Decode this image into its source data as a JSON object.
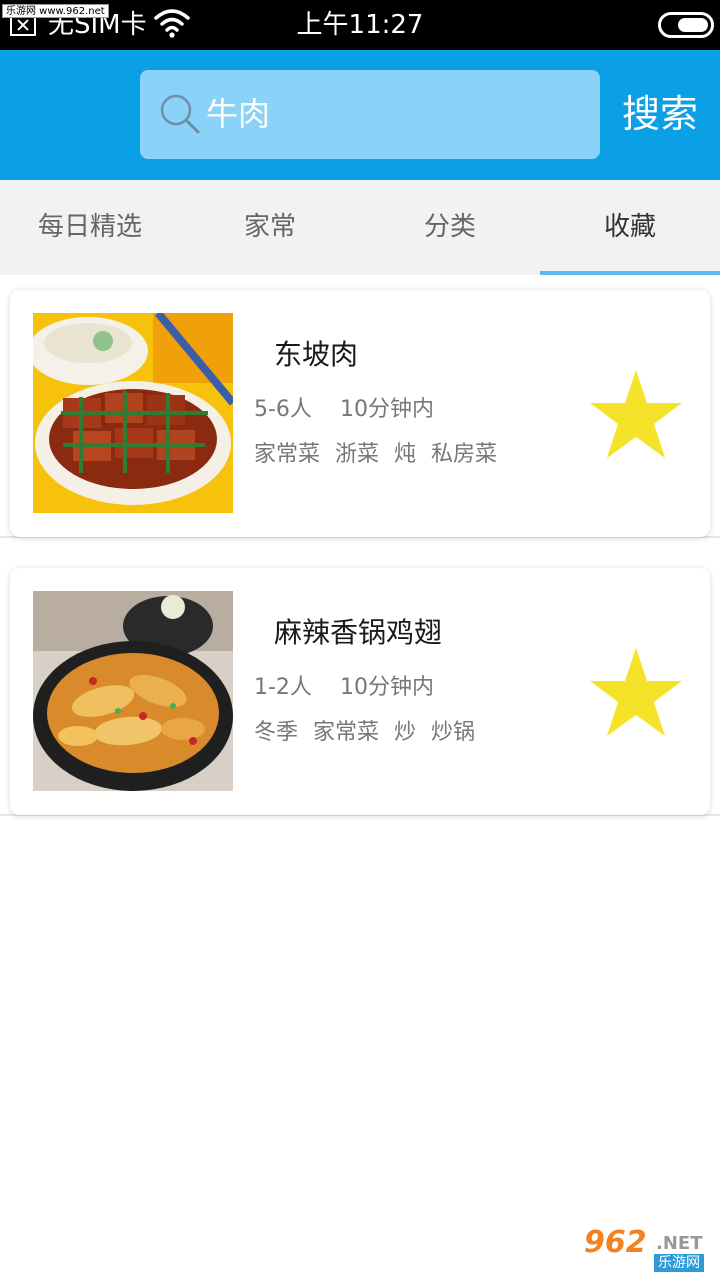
{
  "status_bar": {
    "watermark": "乐游网 www.962.net",
    "carrier": "无SIM卡",
    "time": "上午11:27"
  },
  "search": {
    "query": "牛肉",
    "button_label": "搜索"
  },
  "tabs": [
    {
      "label": "每日精选",
      "active": false
    },
    {
      "label": "家常",
      "active": false
    },
    {
      "label": "分类",
      "active": false
    },
    {
      "label": "收藏",
      "active": true
    }
  ],
  "favorites": [
    {
      "name": "东坡肉",
      "servings": "5-6人",
      "time": "10分钟内",
      "tags": [
        "家常菜",
        "浙菜",
        "炖",
        "私房菜"
      ],
      "favorited": true
    },
    {
      "name": "麻辣香锅鸡翅",
      "servings": "1-2人",
      "time": "10分钟内",
      "tags": [
        "冬季",
        "家常菜",
        "炒",
        "炒锅"
      ],
      "favorited": true
    }
  ],
  "watermark_bottom": {
    "logo_number": "962",
    "logo_suffix": ".NET",
    "logo_cn": "乐游网"
  },
  "colors": {
    "header": "#0b9fe6",
    "search_box": "#8bd2f8",
    "tab_indicator": "#5fb9ec",
    "star": "#f5e32a"
  }
}
